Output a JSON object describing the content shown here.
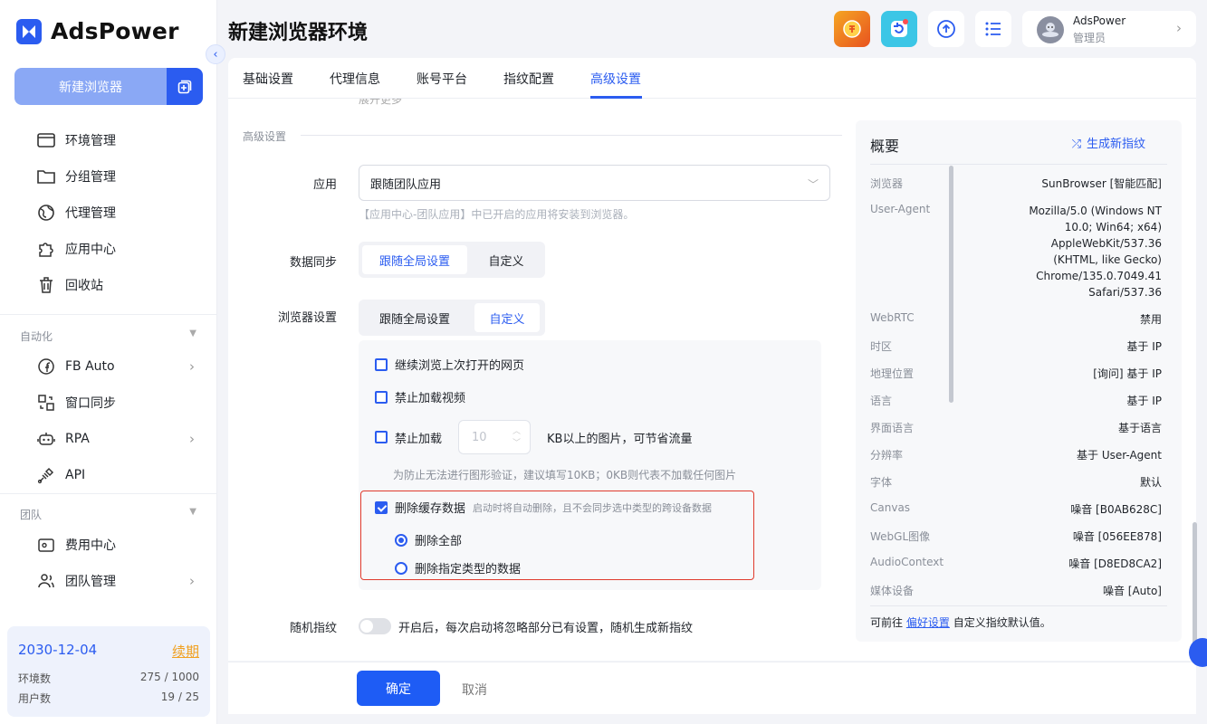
{
  "app": {
    "brand": "AdsPower",
    "page_title": "新建浏览器环境"
  },
  "sidebar": {
    "new_browser": "新建浏览器",
    "items": [
      {
        "label": "环境管理",
        "icon": "browser-window-icon"
      },
      {
        "label": "分组管理",
        "icon": "folder-icon"
      },
      {
        "label": "代理管理",
        "icon": "globe-icon"
      },
      {
        "label": "应用中心",
        "icon": "puzzle-icon"
      },
      {
        "label": "回收站",
        "icon": "trash-icon"
      }
    ],
    "section_automation": "自动化",
    "automation_items": [
      {
        "label": "FB Auto",
        "icon": "facebook-icon"
      },
      {
        "label": "窗口同步",
        "icon": "sync-icon"
      },
      {
        "label": "RPA",
        "icon": "robot-icon"
      },
      {
        "label": "API",
        "icon": "plug-icon"
      }
    ],
    "section_team": "团队",
    "team_items": [
      {
        "label": "费用中心",
        "icon": "wallet-icon"
      },
      {
        "label": "团队管理",
        "icon": "users-icon"
      }
    ],
    "subscription": {
      "date": "2030-12-04",
      "renew": "续期",
      "env_label": "环境数",
      "env_value": "275 / 1000",
      "user_label": "用户数",
      "user_value": "19 / 25"
    }
  },
  "header": {
    "user_name": "AdsPower",
    "user_role": "管理员"
  },
  "tabs": [
    "基础设置",
    "代理信息",
    "账号平台",
    "指纹配置",
    "高级设置"
  ],
  "form": {
    "cut_text": "展开更多",
    "section_title": "高级设置",
    "app_label": "应用",
    "app_value": "跟随团队应用",
    "app_hint": "【应用中心-团队应用】中已开启的应用将安装到浏览器。",
    "sync_label": "数据同步",
    "sync_opt1": "跟随全局设置",
    "sync_opt2": "自定义",
    "browser_label": "浏览器设置",
    "browser_opt1": "跟随全局设置",
    "browser_opt2": "自定义",
    "continue_browsing": "继续浏览上次打开的网页",
    "disable_video": "禁止加载视频",
    "disable_img_prefix": "禁止加载",
    "disable_img_value": "10",
    "disable_img_suffix": "KB以上的图片，可节省流量",
    "img_hint": "为防止无法进行图形验证，建议填写10KB；0KB则代表不加载任何图片",
    "clear_cache": "删除缓存数据",
    "clear_cache_hint": "启动时将自动删除，且不会同步选中类型的跨设备数据",
    "delete_all": "删除全部",
    "delete_specific": "删除指定类型的数据",
    "random_fp_label": "随机指纹",
    "random_fp_text": "开启后，每次启动将忽略部分已有设置，随机生成新指纹"
  },
  "overview": {
    "title": "概要",
    "generate": "生成新指纹",
    "rows": [
      {
        "k": "浏览器",
        "v": "SunBrowser [智能匹配]"
      },
      {
        "k": "User-Agent",
        "v": "Mozilla/5.0 (Windows NT 10.0; Win64; x64) AppleWebKit/537.36 (KHTML, like Gecko) Chrome/135.0.7049.41 Safari/537.36"
      },
      {
        "k": "WebRTC",
        "v": "禁用"
      },
      {
        "k": "时区",
        "v": "基于 IP"
      },
      {
        "k": "地理位置",
        "v": "[询问] 基于 IP"
      },
      {
        "k": "语言",
        "v": "基于 IP"
      },
      {
        "k": "界面语言",
        "v": "基于语言"
      },
      {
        "k": "分辨率",
        "v": "基于 User-Agent"
      },
      {
        "k": "字体",
        "v": "默认"
      },
      {
        "k": "Canvas",
        "v": "噪音 [B0AB628C]"
      },
      {
        "k": "WebGL图像",
        "v": "噪音 [056EE878]"
      },
      {
        "k": "AudioContext",
        "v": "噪音 [D8ED8CA2]"
      },
      {
        "k": "媒体设备",
        "v": "噪音 [Auto]"
      }
    ],
    "foot_prefix": "可前往",
    "foot_link": "偏好设置",
    "foot_suffix": "自定义指纹默认值。"
  },
  "footer": {
    "ok": "确定",
    "cancel": "取消"
  },
  "colors": {
    "accent": "#2b5cf0",
    "highlight_border": "#e03a2c"
  }
}
